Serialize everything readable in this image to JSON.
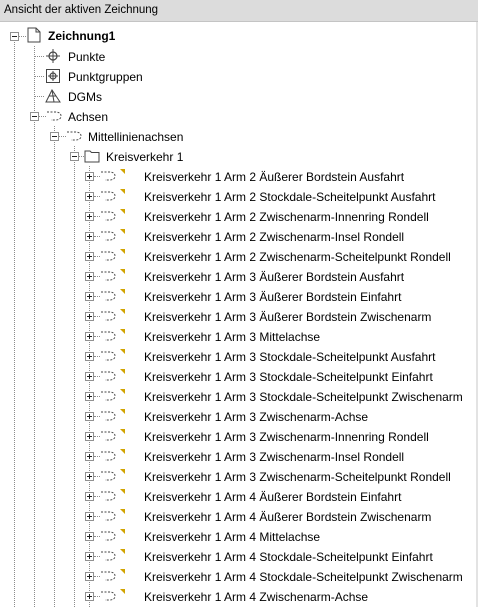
{
  "window": {
    "title": "Ansicht der aktiven Zeichnung"
  },
  "tree": {
    "root_label": "Zeichnung1",
    "punkte_label": "Punkte",
    "punktgruppen_label": "Punktgruppen",
    "dgms_label": "DGMs",
    "achsen_label": "Achsen",
    "mittellinienachsen_label": "Mittellinienachsen",
    "kreisverkehr_label": "Kreisverkehr 1",
    "alignments": [
      "Kreisverkehr 1 Arm 2 Äußerer Bordstein Ausfahrt",
      "Kreisverkehr 1 Arm 2 Stockdale-Scheitelpunkt Ausfahrt",
      "Kreisverkehr 1 Arm 2 Zwischenarm-Innenring Rondell",
      "Kreisverkehr 1 Arm 2 Zwischenarm-Insel Rondell",
      "Kreisverkehr 1 Arm 2 Zwischenarm-Scheitelpunkt Rondell",
      "Kreisverkehr 1 Arm 3 Äußerer Bordstein Ausfahrt",
      "Kreisverkehr 1 Arm 3 Äußerer Bordstein Einfahrt",
      "Kreisverkehr 1 Arm 3 Äußerer Bordstein Zwischenarm",
      "Kreisverkehr 1 Arm 3 Mittelachse",
      "Kreisverkehr 1 Arm 3 Stockdale-Scheitelpunkt Ausfahrt",
      "Kreisverkehr 1 Arm 3 Stockdale-Scheitelpunkt Einfahrt",
      "Kreisverkehr 1 Arm 3 Stockdale-Scheitelpunkt Zwischenarm",
      "Kreisverkehr 1 Arm 3 Zwischenarm-Achse",
      "Kreisverkehr 1 Arm 3 Zwischenarm-Innenring Rondell",
      "Kreisverkehr 1 Arm 3 Zwischenarm-Insel Rondell",
      "Kreisverkehr 1 Arm 3 Zwischenarm-Scheitelpunkt Rondell",
      "Kreisverkehr 1 Arm 4 Äußerer Bordstein Einfahrt",
      "Kreisverkehr 1 Arm 4 Äußerer Bordstein Zwischenarm",
      "Kreisverkehr 1 Arm 4 Mittelachse",
      "Kreisverkehr 1 Arm 4 Stockdale-Scheitelpunkt Einfahrt",
      "Kreisverkehr 1 Arm 4 Stockdale-Scheitelpunkt Zwischenarm",
      "Kreisverkehr 1 Arm 4 Zwischenarm-Achse"
    ]
  }
}
